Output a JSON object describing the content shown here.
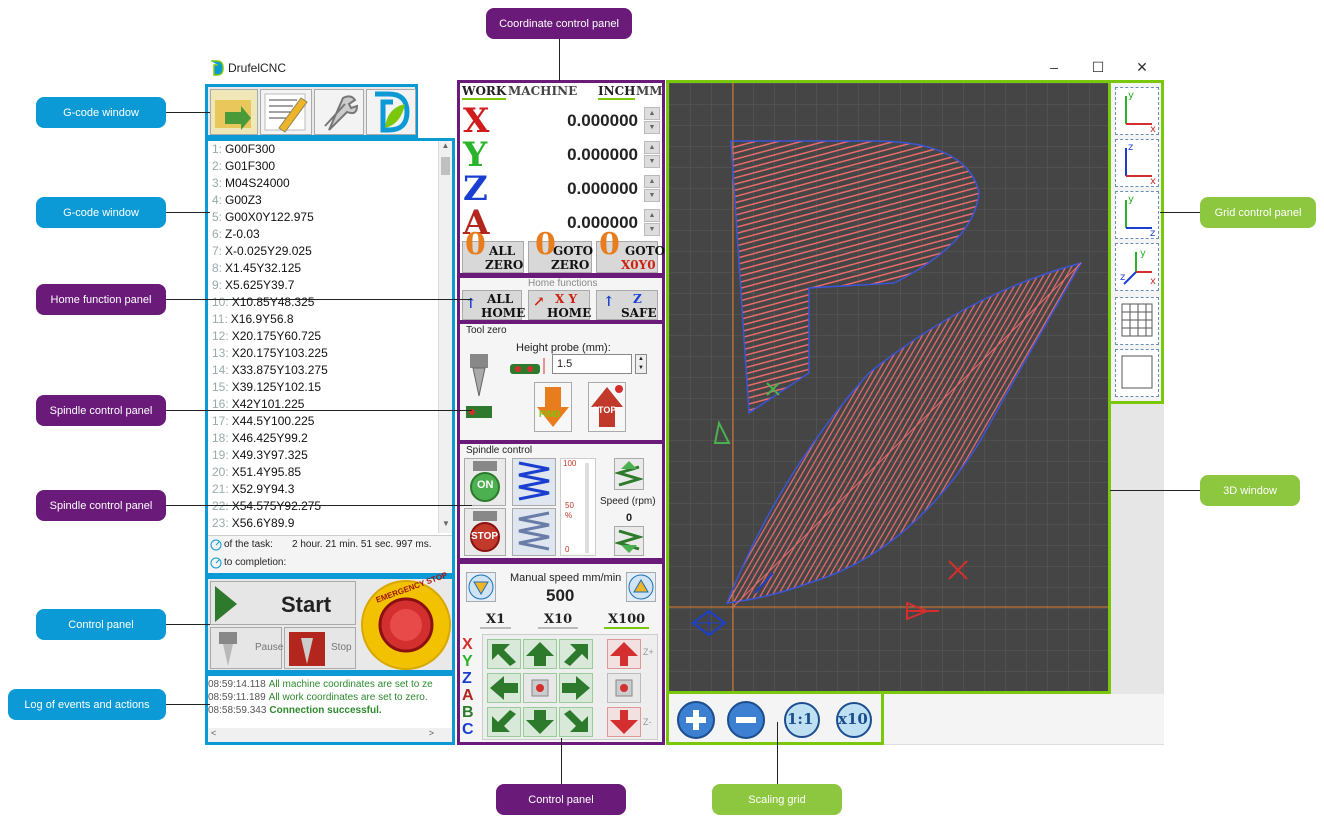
{
  "window": {
    "title": "DrufelCNC",
    "minimize": "–",
    "maximize": "☐",
    "close": "✕"
  },
  "callouts": {
    "top": "Coordinate control panel",
    "gcode1": "G-code window",
    "gcode2": "G-code window",
    "home": "Home function panel",
    "spindle1": "Spindle control panel",
    "spindle2": "Spindle control panel",
    "control_left": "Control panel",
    "log": "Log of events and actions",
    "control_bottom": "Control panel",
    "scaling": "Scaling grid",
    "grid": "Grid control panel",
    "window3d": "3D window"
  },
  "gcode": {
    "lines": [
      {
        "n": "1:",
        "t": "G00F300"
      },
      {
        "n": "2:",
        "t": "G01F300"
      },
      {
        "n": "3:",
        "t": "M04S24000"
      },
      {
        "n": "4:",
        "t": "G00Z3"
      },
      {
        "n": "5:",
        "t": "G00X0Y122.975"
      },
      {
        "n": "6:",
        "t": "Z-0.03"
      },
      {
        "n": "7:",
        "t": "X-0.025Y29.025"
      },
      {
        "n": "8:",
        "t": "X1.45Y32.125"
      },
      {
        "n": "9:",
        "t": "X5.625Y39.7"
      },
      {
        "n": "10:",
        "t": "X10.85Y48.325"
      },
      {
        "n": "11:",
        "t": "X16.9Y56.8"
      },
      {
        "n": "12:",
        "t": "X20.175Y60.725"
      },
      {
        "n": "13:",
        "t": "X20.175Y103.225"
      },
      {
        "n": "14:",
        "t": "X33.875Y103.275"
      },
      {
        "n": "15:",
        "t": "X39.125Y102.15"
      },
      {
        "n": "16:",
        "t": "X42Y101.225"
      },
      {
        "n": "17:",
        "t": "X44.5Y100.225"
      },
      {
        "n": "18:",
        "t": "X46.425Y99.2"
      },
      {
        "n": "19:",
        "t": "X49.3Y97.325"
      },
      {
        "n": "20:",
        "t": "X51.4Y95.85"
      },
      {
        "n": "21:",
        "t": "X52.9Y94.3"
      },
      {
        "n": "22:",
        "t": "X54.575Y92.275"
      },
      {
        "n": "23:",
        "t": "X56.6Y89.9"
      }
    ],
    "task_label": "of the task:",
    "task_time": "2 hour. 21 min. 51 sec. 997 ms.",
    "completion_label": "to completion:"
  },
  "control": {
    "start": "Start",
    "pause": "Pause",
    "stop": "Stop",
    "emergency": "EMERGENCY STOP"
  },
  "log": {
    "entries": [
      {
        "time": "08:59:14.118",
        "text": "All machine coordinates are set to ze"
      },
      {
        "time": "08:59:11.189",
        "text": "All work coordinates are set to zero."
      },
      {
        "time": "08:58:59.343",
        "text": "Connection successful."
      }
    ]
  },
  "coords": {
    "tabs": {
      "work": "WORK",
      "machine": "MACHINE",
      "inch": "INCH",
      "mm": "MM"
    },
    "x": "0.000000",
    "y": "0.000000",
    "z": "0.000000",
    "a": "0.000000",
    "buttons": {
      "all_zero_1": "ALL",
      "all_zero_2": "ZERO",
      "goto_zero_1": "GOTO",
      "goto_zero_2": "ZERO",
      "goto_x0y0_1": "GOTO",
      "goto_x0y0_2": "X0Y0"
    }
  },
  "home": {
    "title": "Home functions",
    "all_home_1": "ALL",
    "all_home_2": "HOME",
    "xy_home_1": "X Y",
    "xy_home_2": "HOME",
    "z_safe_1": "Z",
    "z_safe_2": "SAFE"
  },
  "tool_zero": {
    "title": "Tool zero",
    "height_label": "Height probe (mm):",
    "height_value": "1.5",
    "find": "FIND",
    "stop": "STOP"
  },
  "spindle": {
    "title": "Spindle control",
    "on": "ON",
    "stop": "STOP",
    "scale_100": "100",
    "scale_50": "50",
    "scale_pct": "%",
    "scale_0": "0",
    "speed_label": "Speed (rpm)",
    "speed_value": "0"
  },
  "manual": {
    "title": "Manual speed mm/min",
    "value": "500",
    "x1": "X1",
    "x10": "X10",
    "x100": "X100",
    "axes": [
      "X",
      "Y",
      "Z",
      "A",
      "B",
      "C"
    ],
    "zplus": "Z+",
    "zminus": "Z-"
  },
  "scale": {
    "ratio": "1:1",
    "x10": "x10"
  },
  "axis_labels": {
    "y": "y",
    "x": "x",
    "z": "z"
  },
  "colors": {
    "blue": "#0b9ad6",
    "purple": "#6a1b7a",
    "green": "#7ac70c",
    "viewport": "#454545",
    "toolpath": "#e86b6b"
  }
}
